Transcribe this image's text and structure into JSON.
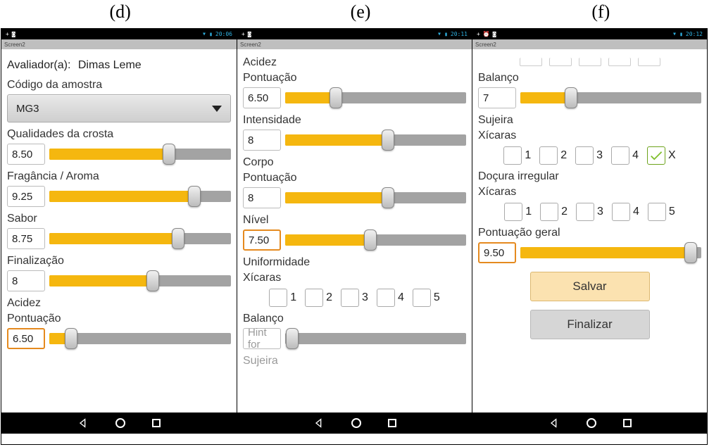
{
  "panel_tags": {
    "d": "(d)",
    "e": "(e)",
    "f": "(f)"
  },
  "statusbar": {
    "time_d": "20:06",
    "time_e": "20:11",
    "time_f": "20:12",
    "app_title": "Screen2"
  },
  "screen_d": {
    "evaluator_label": "Avaliador(a):",
    "evaluator_name": "Dimas  Leme",
    "sample_code_label": "Código da amostra",
    "sample_code_value": "MG3",
    "crust_label": "Qualidades da crosta",
    "crust_value": "8.50",
    "fragrance_label": "Fragância / Aroma",
    "fragrance_value": "9.25",
    "flavor_label": "Sabor",
    "flavor_value": "8.75",
    "finish_label": "Finalização",
    "finish_value": "8",
    "acidity_label": "Acidez",
    "score_label": "Pontuação",
    "acidity_value": "6.50"
  },
  "screen_e": {
    "acidity_label": "Acidez",
    "score_label": "Pontuação",
    "acidity_value": "6.50",
    "intensity_label": "Intensidade",
    "intensity_value": "8",
    "body_label": "Corpo",
    "body_score_value": "8",
    "level_label": "Nível",
    "level_value": "7.50",
    "uniformity_label": "Uniformidade",
    "cups_label": "Xícaras",
    "balance_label": "Balanço",
    "balance_placeholder": "Hint for",
    "sujeira_label": "Sujeira",
    "cup_numbers": {
      "c1": "1",
      "c2": "2",
      "c3": "3",
      "c4": "4",
      "c5": "5"
    }
  },
  "screen_f": {
    "balance_label": "Balanço",
    "balance_value": "7",
    "dirt_label": "Sujeira",
    "cups_label": "Xícaras",
    "sweet_label": "Doçura irregular",
    "overall_label": "Pontuação geral",
    "overall_value": "9.50",
    "save_label": "Salvar",
    "finalize_label": "Finalizar",
    "dirt_cups": {
      "c1": "1",
      "c2": "2",
      "c3": "3",
      "c4": "4",
      "cx": "X"
    },
    "sweet_cups": {
      "c1": "1",
      "c2": "2",
      "c3": "3",
      "c4": "4",
      "c5": "5"
    }
  }
}
